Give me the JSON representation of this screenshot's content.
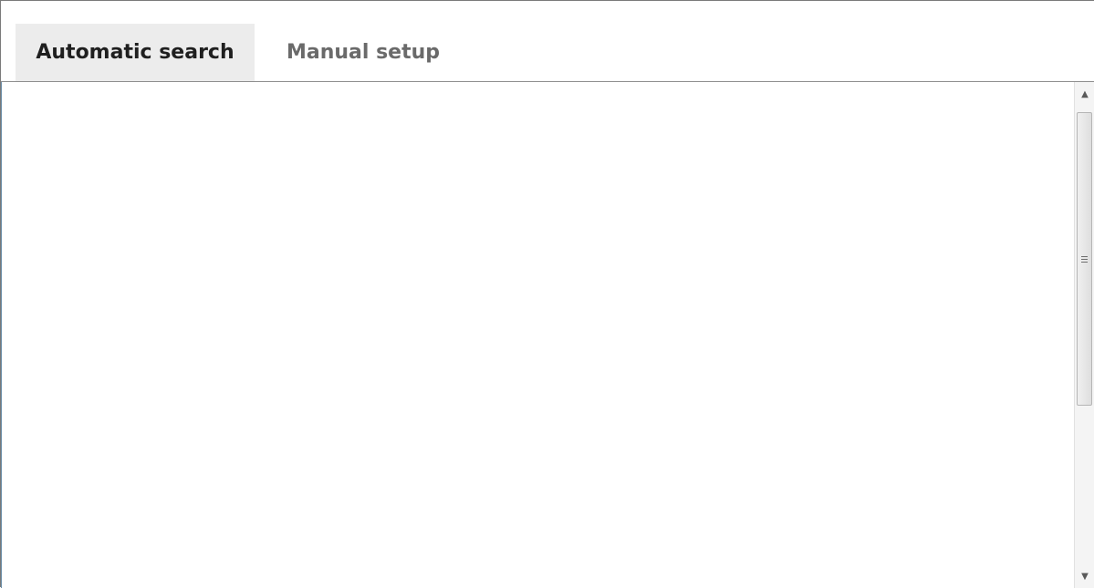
{
  "tabs": [
    {
      "label": "Automatic search",
      "active": true
    },
    {
      "label": "Manual setup",
      "active": false
    }
  ],
  "scrollbar": {
    "up_icon": "scroll-up-arrow-icon",
    "down_icon": "scroll-down-arrow-icon"
  },
  "colors": {
    "active_tab_bg": "#ececec",
    "active_tab_text": "#1f1f1f",
    "inactive_tab_text": "#6a6a6a",
    "background": "#ffffff"
  }
}
